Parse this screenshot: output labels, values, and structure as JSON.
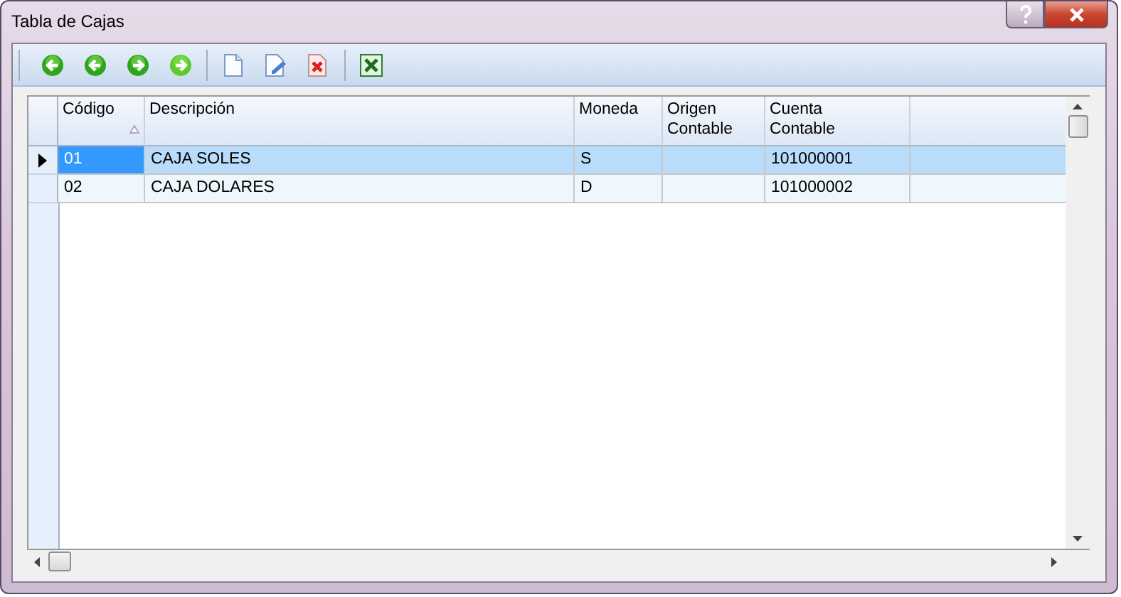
{
  "window": {
    "title": "Tabla de Cajas"
  },
  "toolbar": [
    {
      "kind": "first"
    },
    {
      "kind": "prev"
    },
    {
      "kind": "next"
    },
    {
      "kind": "last"
    },
    {
      "kind": "sep"
    },
    {
      "kind": "new"
    },
    {
      "kind": "edit"
    },
    {
      "kind": "delete"
    },
    {
      "kind": "sep"
    },
    {
      "kind": "excel"
    }
  ],
  "table": {
    "columns": [
      {
        "label": "Código",
        "sorted": true
      },
      {
        "label": "Descripción",
        "sorted": false
      },
      {
        "label": "Moneda",
        "sorted": false
      },
      {
        "label": "Origen Contable",
        "sorted": false
      },
      {
        "label": "Cuenta Contable",
        "sorted": false
      }
    ],
    "rows": [
      {
        "selected": true,
        "cells": [
          "01",
          "CAJA SOLES",
          "S",
          "",
          "101000001"
        ]
      },
      {
        "selected": false,
        "cells": [
          "02",
          "CAJA DOLARES",
          "D",
          "",
          "101000002"
        ]
      }
    ]
  }
}
